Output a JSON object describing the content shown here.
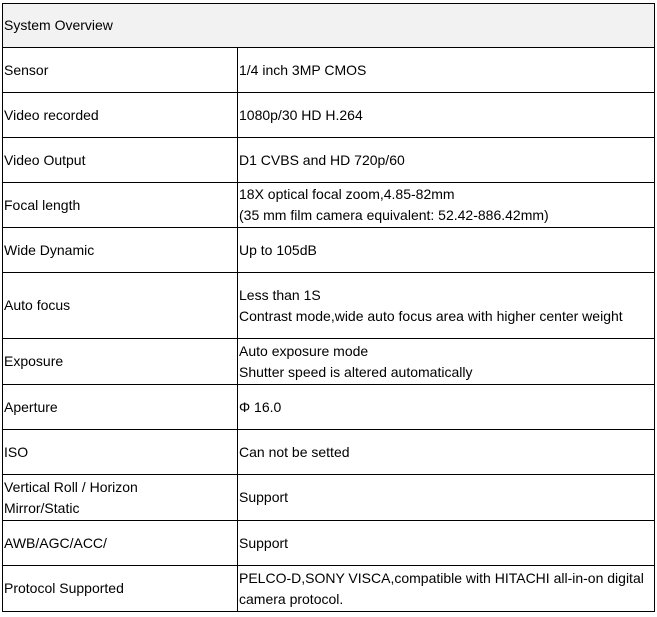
{
  "table": {
    "header": "System Overview",
    "rows": [
      {
        "label": "Sensor",
        "value": [
          "1/4 inch 3MP CMOS"
        ]
      },
      {
        "label": "Video recorded",
        "value": [
          "1080p/30 HD H.264"
        ]
      },
      {
        "label": "Video Output",
        "value": [
          "D1 CVBS and HD 720p/60"
        ]
      },
      {
        "label": "Focal length",
        "value": [
          "18X optical focal zoom,4.85-82mm",
          "(35 mm film camera equivalent: 52.42-886.42mm)"
        ]
      },
      {
        "label": "Wide Dynamic",
        "value": [
          "Up to 105dB"
        ]
      },
      {
        "label": "Auto focus",
        "value": [
          "Less than 1S",
          "Contrast mode,wide auto focus area with higher center weight"
        ]
      },
      {
        "label": "Exposure",
        "value": [
          "Auto exposure mode",
          "Shutter speed is altered automatically"
        ]
      },
      {
        "label": "Aperture",
        "value": [
          "Φ 16.0"
        ]
      },
      {
        "label": "ISO",
        "value": [
          "Can not be setted"
        ]
      },
      {
        "label": "Vertical Roll / Horizon Mirror/Static",
        "value": [
          "Support"
        ]
      },
      {
        "label": "AWB/AGC/ACC/",
        "value": [
          "Support"
        ]
      },
      {
        "label": "Protocol Supported",
        "value": [
          "PELCO-D,SONY VISCA,compatible with HITACHI all-in-on digital camera protocol."
        ]
      }
    ]
  }
}
